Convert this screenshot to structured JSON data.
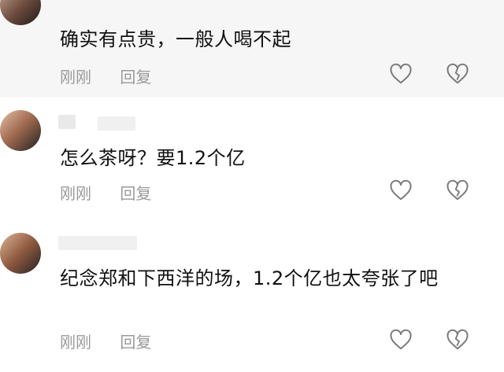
{
  "comments": [
    {
      "text": "确实有点贵，一般人喝不起",
      "time": "刚刚",
      "reply": "回复"
    },
    {
      "text": "怎么茶呀？要1.2个亿",
      "time": "刚刚",
      "reply": "回复"
    },
    {
      "text": "纪念郑和下西洋的场，1.2个亿也太夸张了吧",
      "time": "刚刚",
      "reply": "回复"
    }
  ],
  "icons": {
    "like": "heart-outline-icon",
    "dislike": "broken-heart-icon"
  },
  "colors": {
    "text": "#111111",
    "meta": "#9a9a9a",
    "icon": "#7a7a7a",
    "first_bg": "#f6f6f6"
  }
}
